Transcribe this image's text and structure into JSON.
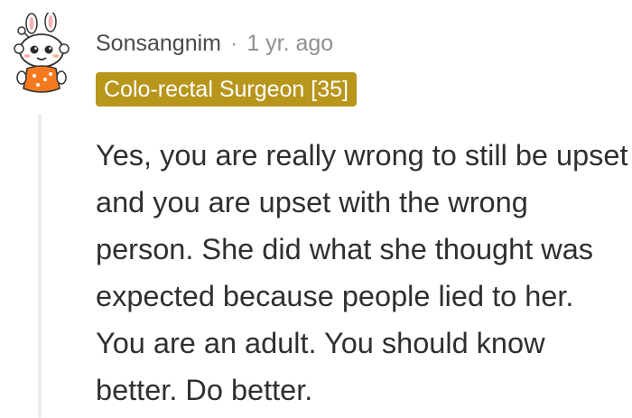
{
  "comment": {
    "username": "Sonsangnim",
    "separator": "·",
    "timestamp": "1 yr. ago",
    "flair": "Colo-rectal Surgeon [35]",
    "body": "Yes, you are really wrong to still be upset and you are upset with the wrong person. She did what she thought was expected because people lied to her. You are an adult. You should know better. Do better.",
    "avatar_icon": "bunny-hat-snoo-avatar-icon"
  },
  "colors": {
    "flair_background": "#b8961c",
    "flair_text": "#ffffff",
    "username": "#4a4a4a",
    "timestamp": "#8f8f8f",
    "body_text": "#2f2f2f",
    "thread_line": "#ececec"
  }
}
